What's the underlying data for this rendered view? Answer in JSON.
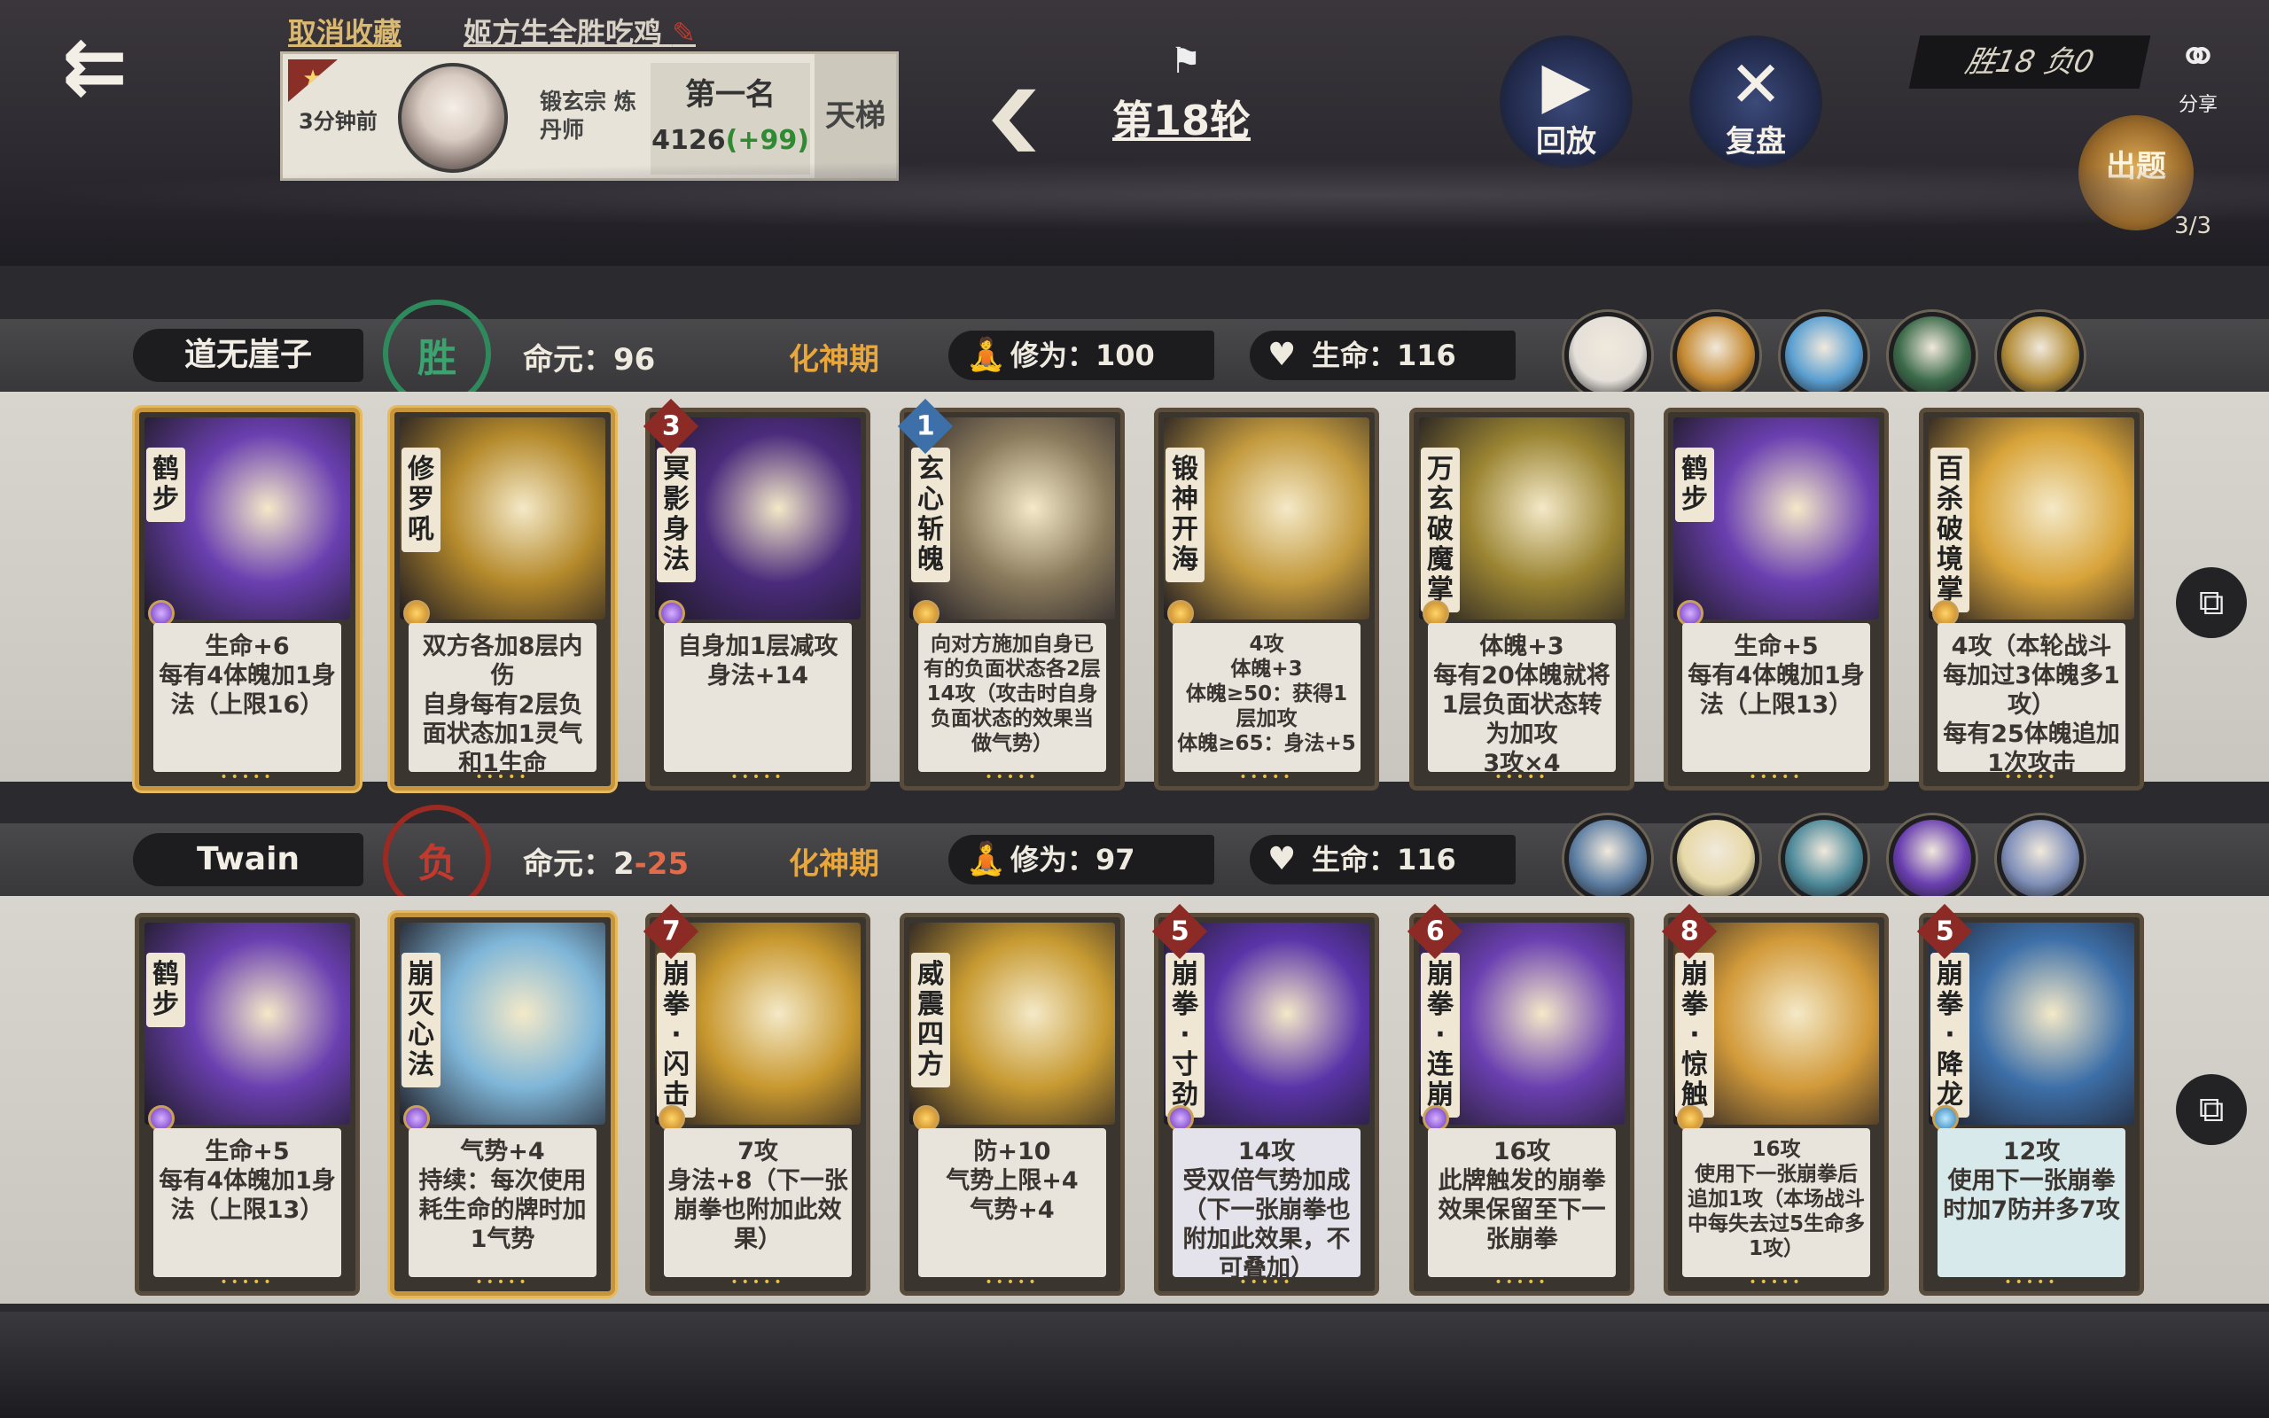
{
  "top": {
    "unfavorite": "取消收藏",
    "match_name": "姬方生全胜吃鸡",
    "edit_icon": "pencil-icon"
  },
  "info": {
    "time": "3分钟前",
    "sect": "锻玄宗 炼丹师",
    "rank": "第一名",
    "score": "4126",
    "delta": "(+99)",
    "mode": "天梯"
  },
  "round": {
    "label": "第18轮"
  },
  "controls": {
    "replay": "回放",
    "review": "复盘"
  },
  "record": {
    "text": "胜18 负0"
  },
  "share": {
    "label": "分享"
  },
  "quiz": {
    "label": "出题",
    "count": "3/3"
  },
  "players": [
    {
      "name": "道无崖子",
      "result": "胜",
      "life_label": "命元：",
      "life": "96",
      "life_extra": "",
      "realm": "化神期",
      "cult_label": "修为：",
      "cult": "100",
      "hp_label": "生命：",
      "hp": "116",
      "avatars": [
        "#e4dfd8",
        "#c58a33",
        "#5a9fd1",
        "#3c6b4a",
        "#b38d3a"
      ],
      "cards": [
        {
          "name": "鹤步",
          "cost": "",
          "gem": "p",
          "art": "#6a3fb0",
          "gold": true,
          "desc": "生命+6\n每有4体魄加1身法（上限16）"
        },
        {
          "name": "修罗吼",
          "cost": "",
          "gem": "o",
          "art": "#b58a2c",
          "gold": true,
          "desc": "双方各加8层内伤\n自身每有2层负面状态加1灵气和1生命"
        },
        {
          "name": "冥影身法",
          "cost": "3",
          "gem": "p",
          "art": "#4a2b7c",
          "gold": false,
          "desc": "自身加1层减攻\n身法+14"
        },
        {
          "name": "玄心斩魄",
          "cost": "1",
          "gem": "o",
          "art": "#8a7a5c",
          "gold": false,
          "blue": true,
          "desc": "向对方施加自身已有的负面状态各2层\n14攻（攻击时自身负面状态的效果当做气势）"
        },
        {
          "name": "锻神开海",
          "cost": "",
          "gem": "o",
          "art": "#c39a3e",
          "gold": false,
          "desc": "4攻\n体魄+3\n体魄≥50：获得1层加攻\n体魄≥65：身法+5"
        },
        {
          "name": "万玄破魔掌",
          "cost": "",
          "gem": "o",
          "art": "#9a8432",
          "gold": false,
          "desc": "体魄+3\n每有20体魄就将1层负面状态转为加攻\n3攻×4"
        },
        {
          "name": "鹤步",
          "cost": "",
          "gem": "p",
          "art": "#6a3fb0",
          "gold": false,
          "desc": "生命+5\n每有4体魄加1身法（上限13）"
        },
        {
          "name": "百杀破境掌",
          "cost": "",
          "gem": "o",
          "art": "#d8a43a",
          "gold": false,
          "desc": "4攻（本轮战斗每加过3体魄多1攻）\n每有25体魄追加1次攻击"
        }
      ]
    },
    {
      "name": "Twain",
      "result": "负",
      "life_label": "命元：",
      "life": "2",
      "life_extra": "-25",
      "realm": "化神期",
      "cult_label": "修为：",
      "cult": "97",
      "hp_label": "生命：",
      "hp": "116",
      "avatars": [
        "#5e7fa3",
        "#e7d9a8",
        "#4e8a9a",
        "#6a3fb0",
        "#7f8fb8"
      ],
      "cards": [
        {
          "name": "鹤步",
          "cost": "",
          "gem": "p",
          "art": "#6a3fb0",
          "gold": false,
          "desc": "生命+5\n每有4体魄加1身法（上限13）"
        },
        {
          "name": "崩灭心法",
          "cost": "",
          "gem": "p",
          "art": "#7fb6d8",
          "gold": true,
          "desc": "气势+4\n持续：每次使用耗生命的牌时加1气势"
        },
        {
          "name": "崩拳·闪击",
          "cost": "7",
          "gem": "o",
          "art": "#c8982f",
          "gold": false,
          "desc": "7攻\n身法+8（下一张崩拳也附加此效果）"
        },
        {
          "name": "威震四方",
          "cost": "",
          "gem": "o",
          "art": "#c79a32",
          "gold": false,
          "desc": "防+10\n气势上限+4\n气势+4"
        },
        {
          "name": "崩拳·寸劲",
          "cost": "5",
          "gem": "p",
          "art": "#5a34a8",
          "gold": false,
          "pp": true,
          "desc": "14攻\n受双倍气势加成（下一张崩拳也附加此效果，不可叠加）"
        },
        {
          "name": "崩拳·连崩",
          "cost": "6",
          "gem": "p",
          "art": "#6a3fb0",
          "gold": false,
          "desc": "16攻\n此牌触发的崩拳效果保留至下一张崩拳"
        },
        {
          "name": "崩拳·惊触",
          "cost": "8",
          "gem": "o",
          "art": "#d29a3a",
          "gold": false,
          "desc": "16攻\n使用下一张崩拳后追加1攻（本场战斗中每失去过5生命多1攻）"
        },
        {
          "name": "崩拳·降龙",
          "cost": "5",
          "gem": "c",
          "art": "#3d6fa8",
          "gold": false,
          "bl": true,
          "desc": "12攻\n使用下一张崩拳时加7防并多7攻"
        }
      ]
    }
  ]
}
